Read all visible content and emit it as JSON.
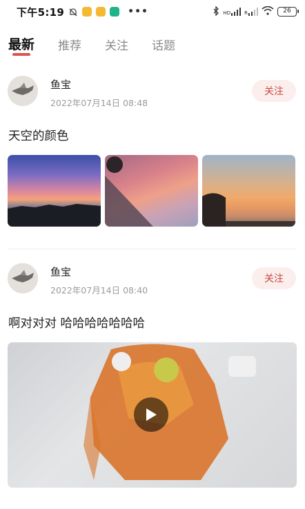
{
  "status_bar": {
    "time": "下午5:19",
    "overflow": "•••",
    "battery": "26",
    "signal_label_1": "HD",
    "signal_label_2": "R"
  },
  "tabs": [
    {
      "label": "最新",
      "active": true
    },
    {
      "label": "推荐",
      "active": false
    },
    {
      "label": "关注",
      "active": false
    },
    {
      "label": "话题",
      "active": false
    }
  ],
  "accent_color": "#d9534f",
  "posts": [
    {
      "username": "鱼宝",
      "date": "2022年07月14日 08:48",
      "follow_label": "关注",
      "text": "天空的颜色",
      "media": "images",
      "image_count": 3
    },
    {
      "username": "鱼宝",
      "date": "2022年07月14日 08:40",
      "follow_label": "关注",
      "text": "啊对对对 哈哈哈哈哈哈哈",
      "media": "video"
    }
  ]
}
